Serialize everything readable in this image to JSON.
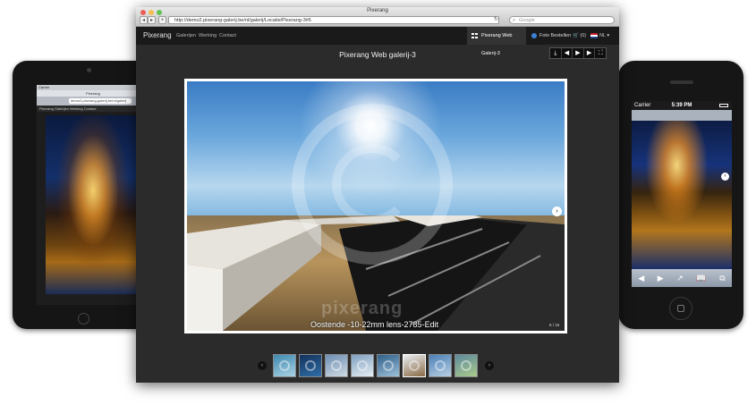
{
  "browser": {
    "window_title": "Pixerang",
    "url": "http://demo2.pixerang-galerij.be/nl/galerij/Locatie/Pixerang-3#6",
    "search_placeholder": "Google",
    "back_icon": "arrow-left-icon",
    "forward_icon": "arrow-right-icon",
    "reload_icon": "reload-icon"
  },
  "site_nav": {
    "brand": "Pixerang",
    "links": [
      "Galerijen",
      "Werking",
      "Contact"
    ],
    "gallery_tab": "Pixerang Web Galerij-3",
    "order_label": "Foto Bestellen",
    "cart_count": "(0)",
    "language": "NL"
  },
  "gallery": {
    "title": "Pixerang Web galerij-3",
    "toolbar": [
      {
        "icon": "download-icon",
        "glyph": "⤓"
      },
      {
        "icon": "previous-icon",
        "glyph": "◀"
      },
      {
        "icon": "play-icon",
        "glyph": "▶"
      },
      {
        "icon": "next-icon",
        "glyph": "▶"
      },
      {
        "icon": "fullscreen-icon",
        "glyph": "⛶"
      }
    ],
    "photo_caption": "Oostende -10-22mm lens-2785-Edit",
    "photo_counter": "6 / 16",
    "watermark": "pixerang",
    "next_arrow": "›",
    "thumb_prev": "‹",
    "thumb_next": "›",
    "thumbnails": [
      {
        "name": "thumb-1",
        "colors": [
          "#3f88b0",
          "#a9d3e3"
        ]
      },
      {
        "name": "thumb-2",
        "colors": [
          "#13325c",
          "#2f6ea6"
        ]
      },
      {
        "name": "thumb-3",
        "colors": [
          "#6d8fb4",
          "#cfd9e2"
        ]
      },
      {
        "name": "thumb-4",
        "colors": [
          "#7fa0c0",
          "#e6eef4"
        ]
      },
      {
        "name": "thumb-5",
        "colors": [
          "#2f5f8a",
          "#9cc0d9"
        ]
      },
      {
        "name": "thumb-6",
        "colors": [
          "#e9eef2",
          "#8b6b45"
        ],
        "active": true
      },
      {
        "name": "thumb-7",
        "colors": [
          "#4c80b8",
          "#b7cfe2"
        ]
      },
      {
        "name": "thumb-8",
        "colors": [
          "#5d8a9c",
          "#a8c98a"
        ]
      }
    ]
  },
  "ipad": {
    "carrier": "Carrier",
    "tab_title": "Pixerang",
    "url": "demo2.pixerang-galerij.be/nl/galerij",
    "nav": "Pixerang  Galerijen  Werking  Contact"
  },
  "iphone": {
    "carrier": "Carrier",
    "time": "5:39 PM",
    "next_arrow": "›",
    "toolbar": [
      "◀",
      "▶",
      "↗",
      "📖",
      "⧉"
    ]
  }
}
